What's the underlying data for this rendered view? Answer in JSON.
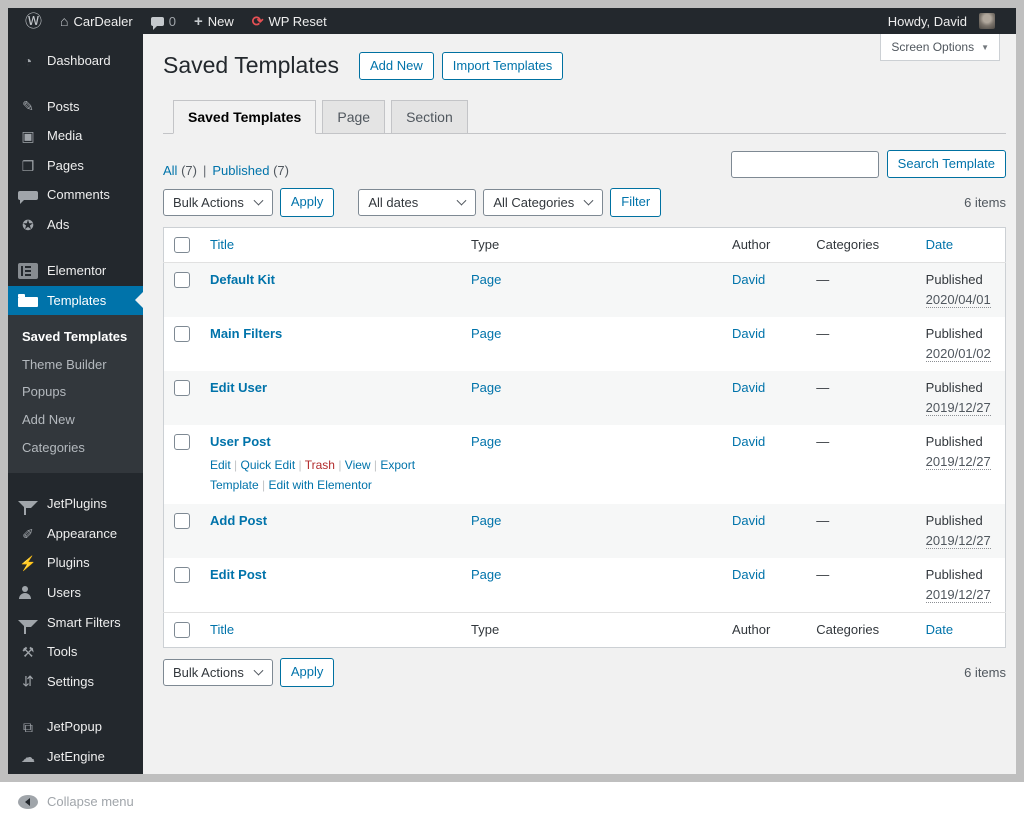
{
  "admin_bar": {
    "site_name": "CarDealer",
    "comments_count": "0",
    "new_label": "New",
    "wp_reset_label": "WP Reset",
    "howdy": "Howdy, David"
  },
  "icons": {
    "wordpress-logo": "Ⓦ",
    "home": "⌂",
    "comments-bubble": "css:bubble",
    "plus": "+",
    "wp-reset": "⟳",
    "screen-options-arrow": "▼",
    "dashboard": "◔",
    "posts": "✎",
    "media": "▣",
    "pages": "❐",
    "comments": "css:bubble",
    "ads": "✪",
    "elementor": "css:elementor",
    "templates": "css:folder",
    "jetplugins": "css:funnel",
    "appearance": "✐",
    "plugins": "⚡",
    "users": "css:person",
    "smart-filters": "css:funnel",
    "tools": "⚒",
    "settings": "⇵",
    "jetpopup": "⧉",
    "jetengine": "☁",
    "collapse": "css:collapse"
  },
  "sidebar": {
    "menu_top": [
      {
        "name": "dashboard",
        "label": "Dashboard",
        "icon": "dashboard"
      },
      {
        "name": "posts",
        "label": "Posts",
        "icon": "posts",
        "gap": true
      },
      {
        "name": "media",
        "label": "Media",
        "icon": "media"
      },
      {
        "name": "pages",
        "label": "Pages",
        "icon": "pages"
      },
      {
        "name": "comments",
        "label": "Comments",
        "icon": "comments"
      },
      {
        "name": "ads",
        "label": "Ads",
        "icon": "ads"
      },
      {
        "name": "elementor",
        "label": "Elementor",
        "icon": "elementor",
        "gap": true
      },
      {
        "name": "templates",
        "label": "Templates",
        "icon": "templates",
        "active": true
      }
    ],
    "submenu": [
      {
        "name": "saved-templates",
        "label": "Saved Templates",
        "current": true
      },
      {
        "name": "theme-builder",
        "label": "Theme Builder"
      },
      {
        "name": "popups",
        "label": "Popups"
      },
      {
        "name": "add-new",
        "label": "Add New"
      },
      {
        "name": "categories",
        "label": "Categories"
      }
    ],
    "menu_bottom": [
      {
        "name": "jetplugins",
        "label": "JetPlugins",
        "icon": "jetplugins"
      },
      {
        "name": "appearance",
        "label": "Appearance",
        "icon": "appearance"
      },
      {
        "name": "plugins",
        "label": "Plugins",
        "icon": "plugins"
      },
      {
        "name": "users",
        "label": "Users",
        "icon": "users"
      },
      {
        "name": "smart-filters",
        "label": "Smart Filters",
        "icon": "smart-filters"
      },
      {
        "name": "tools",
        "label": "Tools",
        "icon": "tools"
      },
      {
        "name": "settings",
        "label": "Settings",
        "icon": "settings"
      },
      {
        "name": "jetpopup",
        "label": "JetPopup",
        "icon": "jetpopup",
        "gap": true
      },
      {
        "name": "jetengine",
        "label": "JetEngine",
        "icon": "jetengine"
      },
      {
        "name": "collapse-menu",
        "label": "Collapse menu",
        "icon": "collapse",
        "gap": true,
        "dim": true
      }
    ]
  },
  "page": {
    "title": "Saved Templates",
    "add_new": "Add New",
    "import": "Import Templates",
    "screen_options": "Screen Options",
    "tabs": [
      "Saved Templates",
      "Page",
      "Section"
    ],
    "filter_links": [
      {
        "label": "All",
        "count": "(7)"
      },
      {
        "label": "Published",
        "count": "(7)"
      }
    ],
    "search_button": "Search Template",
    "bulk_actions": "Bulk Actions",
    "apply": "Apply",
    "all_dates": "All dates",
    "all_categories": "All Categories",
    "filter": "Filter",
    "items_count": "6 items"
  },
  "table": {
    "columns": [
      {
        "label": "Title",
        "sortable": true
      },
      {
        "label": "Type",
        "sortable": false
      },
      {
        "label": "Author",
        "sortable": false
      },
      {
        "label": "Categories",
        "sortable": false
      },
      {
        "label": "Date",
        "sortable": true
      }
    ],
    "row_actions": [
      {
        "label": "Edit",
        "name": "edit"
      },
      {
        "label": "Quick Edit",
        "name": "quick-edit"
      },
      {
        "label": "Trash",
        "name": "trash",
        "danger": true
      },
      {
        "label": "View",
        "name": "view"
      },
      {
        "label": "Export Template",
        "name": "export-template"
      },
      {
        "label": "Edit with Elementor",
        "name": "edit-with-elementor"
      }
    ],
    "rows": [
      {
        "title": "Default Kit",
        "type": "Page",
        "author": "David",
        "categories": "—",
        "status": "Published",
        "date": "2020/04/01"
      },
      {
        "title": "Main Filters",
        "type": "Page",
        "author": "David",
        "categories": "—",
        "status": "Published",
        "date": "2020/01/02"
      },
      {
        "title": "Edit User",
        "type": "Page",
        "author": "David",
        "categories": "—",
        "status": "Published",
        "date": "2019/12/27"
      },
      {
        "title": "User Post",
        "type": "Page",
        "author": "David",
        "categories": "—",
        "status": "Published",
        "date": "2019/12/27"
      },
      {
        "title": "Add Post",
        "type": "Page",
        "author": "David",
        "categories": "—",
        "status": "Published",
        "date": "2019/12/27"
      },
      {
        "title": "Edit Post",
        "type": "Page",
        "author": "David",
        "categories": "—",
        "status": "Published",
        "date": "2019/12/27"
      }
    ]
  }
}
